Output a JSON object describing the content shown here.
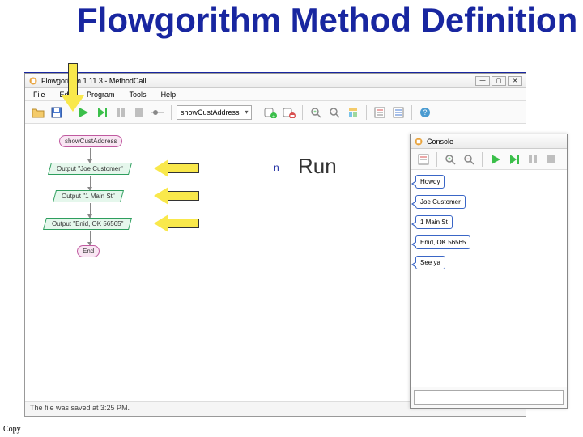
{
  "slide": {
    "title": "Flowgorithm Method Definition"
  },
  "bullet": {
    "marker": "n",
    "text": "Run"
  },
  "mainWindow": {
    "title": "Flowgorithm 1.11.3 - MethodCall",
    "menu": [
      "File",
      "Edit",
      "Program",
      "Tools",
      "Help"
    ],
    "functionSelector": "showCustAddress",
    "statusBar": "The file was saved at 3:25 PM."
  },
  "flowchart": {
    "start": "showCustAddress",
    "outputs": [
      "Output \"Joe Customer\"",
      "Output \"1 Main St\"",
      "Output \"Enid, OK   56565\""
    ],
    "end": "End"
  },
  "console": {
    "title": "Console",
    "lines": [
      "Howdy",
      "Joe Customer",
      "1 Main St",
      "Enid, OK  56565",
      "See ya"
    ]
  },
  "footer": {
    "copyright": "Copy"
  }
}
